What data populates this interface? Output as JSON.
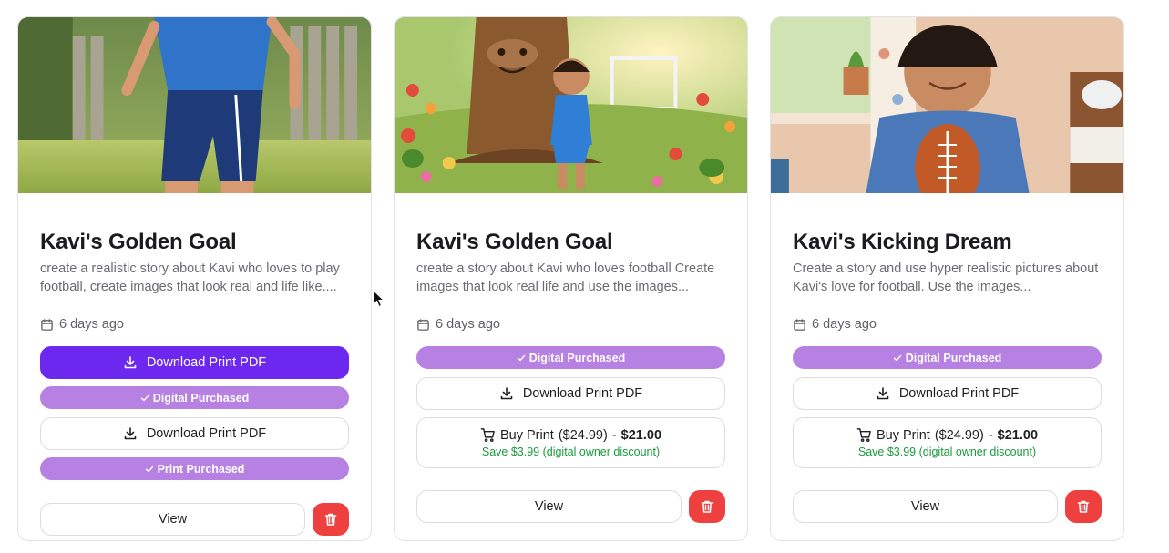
{
  "cards": [
    {
      "title": "Kavi's Golden Goal",
      "description": "create a realistic story about Kavi who loves to play football, create images that look real and life like....",
      "date": "6 days ago",
      "primary_download_label": "Download Print PDF",
      "digital_badge": "Digital Purchased",
      "secondary_download_label": "Download Print PDF",
      "print_badge": "Print Purchased",
      "view_label": "View"
    },
    {
      "title": "Kavi's Golden Goal",
      "description": "create a story about Kavi who loves football Create images that look real life and use the images...",
      "date": "6 days ago",
      "digital_badge": "Digital Purchased",
      "download_label": "Download Print PDF",
      "buy_label": "Buy Print",
      "old_price": "($24.99)",
      "price_separator": "-",
      "new_price": "$21.00",
      "discount_note": "Save $3.99 (digital owner discount)",
      "view_label": "View"
    },
    {
      "title": "Kavi's Kicking Dream",
      "description": "Create a story and use hyper realistic pictures about Kavi's love for football. Use the images...",
      "date": "6 days ago",
      "digital_badge": "Digital Purchased",
      "download_label": "Download Print PDF",
      "buy_label": "Buy Print",
      "old_price": "($24.99)",
      "price_separator": "-",
      "new_price": "$21.00",
      "discount_note": "Save $3.99 (digital owner discount)",
      "view_label": "View"
    }
  ],
  "icons": {
    "calendar": "calendar-icon",
    "download": "download-icon",
    "check": "check-icon",
    "cart": "shopping-cart-icon",
    "trash": "trash-icon",
    "cursor": "mouse-pointer-icon"
  },
  "colors": {
    "primary": "#6d28f0",
    "badge": "#b681e3",
    "danger": "#ef4040",
    "discount": "#1a9b3c"
  }
}
